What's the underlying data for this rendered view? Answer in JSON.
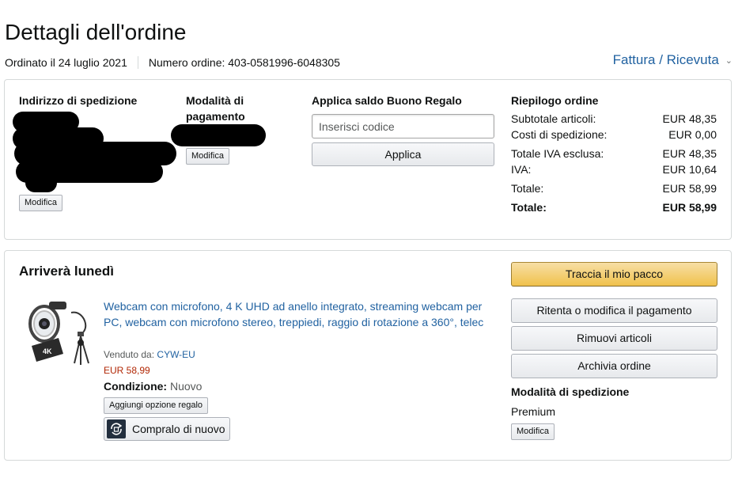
{
  "header": {
    "title": "Dettagli dell'ordine",
    "ordered_on": "Ordinato il 24 luglio 2021",
    "order_number": "Numero ordine: 403-0581996-6048305",
    "invoice_link": "Fattura / Ricevuta"
  },
  "summary_box": {
    "address": {
      "title": "Indirizzo di spedizione",
      "edit": "Modifica"
    },
    "payment": {
      "title": "Modalità di pagamento",
      "edit": "Modifica"
    },
    "gift": {
      "title": "Applica saldo Buono Regalo",
      "placeholder": "Inserisci codice",
      "apply": "Applica"
    },
    "order_summary": {
      "title": "Riepilogo ordine",
      "rows": [
        {
          "label": "Subtotale articoli:",
          "value": "EUR 48,35"
        },
        {
          "label": "Costi di spedizione:",
          "value": "EUR 0,00"
        },
        {
          "label": "Totale IVA esclusa:",
          "value": "EUR 48,35"
        },
        {
          "label": "IVA:",
          "value": "EUR 10,64"
        },
        {
          "label": "Totale:",
          "value": "EUR 58,99"
        },
        {
          "label": "Totale:",
          "value": "EUR 58,99"
        }
      ]
    }
  },
  "shipment": {
    "title": "Arriverà lunedì",
    "product": {
      "title": "Webcam con microfono, 4 K UHD ad anello integrato, streaming webcam per PC, webcam con microfono stereo, treppiedi, raggio di rotazione a 360°, telec",
      "sold_by_label": "Venduto da:",
      "seller": "CYW-EU",
      "price": "EUR 58,99",
      "condition_label": "Condizione:",
      "condition_value": "Nuovo",
      "gift_option": "Aggiungi opzione regalo",
      "buy_again": "Compralo di nuovo",
      "badge": "4K"
    },
    "actions": {
      "track": "Traccia il mio pacco",
      "retry_payment": "Ritenta o modifica il pagamento",
      "remove": "Rimuovi articoli",
      "archive": "Archivia ordine"
    },
    "shipping_method": {
      "title": "Modalità di spedizione",
      "value": "Premium",
      "edit": "Modifica"
    }
  },
  "colors": {
    "link": "#2162a1",
    "price": "#b12704",
    "primary_button": "#f0c14b",
    "border": "#d5d9d9"
  }
}
